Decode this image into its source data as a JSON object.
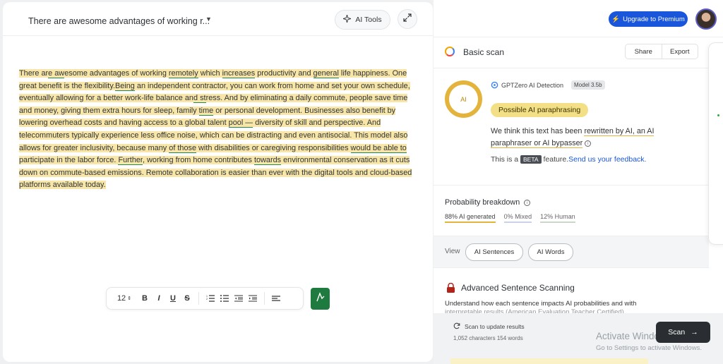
{
  "editor": {
    "doc_title": "There are awesome advantages of working r...",
    "ai_tools_label": "AI Tools",
    "paragraph": [
      {
        "t": "There ar",
        "u": false
      },
      {
        "t": "e aw",
        "u": true
      },
      {
        "t": "esome advantages of working ",
        "u": false
      },
      {
        "t": "remotely",
        "u": true
      },
      {
        "t": " which ",
        "u": false
      },
      {
        "t": "increases",
        "u": true
      },
      {
        "t": "  productivity and ",
        "u": false
      },
      {
        "t": "general",
        "u": true
      },
      {
        "t": " life happiness. ",
        "u": false
      },
      {
        "t": "One great benefit is the flexibility.",
        "u": false
      },
      {
        "t": "Being",
        "u": true
      },
      {
        "t": " an independent contractor, you can work from home and set your own schedule, eventually allowing for  a better work-life balance an",
        "u": false
      },
      {
        "t": "d st",
        "u": true
      },
      {
        "t": "ress. And by eliminating a daily commute, people save time and money, giving them extra  hours for sleep, family ",
        "u": false
      },
      {
        "t": "time",
        "u": true
      },
      {
        "t": " or personal development. Businesses also benefit  by lowering overhead costs and having access to a global talent ",
        "u": false
      },
      {
        "t": "pool —",
        "u": true
      },
      {
        "t": " diversity of skill and perspective. And telecommuters typically  experience less office noise, which can be distracting and even antisocial. This model also allows for greater inclusivity, because many ",
        "u": false
      },
      {
        "t": "of those",
        "u": true
      },
      {
        "t": " with disabilities or caregiving responsibilities ",
        "u": false
      },
      {
        "t": "would be able to",
        "u": true
      },
      {
        "t": " participate  in the labor force. ",
        "u": false
      },
      {
        "t": "Further",
        "u": true
      },
      {
        "t": ", working from home contributes ",
        "u": false
      },
      {
        "t": "towards",
        "u": true
      },
      {
        "t": "  environmental conservation as it cuts down on commute-based emissions. Remote collaboration is easier than ever with the digital tools and cloud-based platforms available  today.",
        "u": false
      }
    ],
    "toolbar": {
      "font_size": "12",
      "bold": "B",
      "italic": "I",
      "underline": "U",
      "strike": "S"
    }
  },
  "panel": {
    "upgrade_label": "Upgrade to Premium",
    "title": "Basic scan",
    "share": "Share",
    "export": "Export",
    "ring_label": "AI",
    "detector": "GPTZero AI Detection",
    "model": "Model 3.5b",
    "verdict": "Possible AI paraphrasing",
    "explain_pre": "We think this text has been ",
    "explain_hl": "rewritten by AI, an AI paraphraser or AI bypasser",
    "beta_pre": "This is a ",
    "beta": "BETA",
    "beta_post": " feature.",
    "feedback": "Send us your feedback.",
    "prob_title": "Probability breakdown",
    "prob_ai": "88% AI generated",
    "prob_mixed": "0% Mixed",
    "prob_human": "12% Human",
    "view": "View",
    "ai_sentences": "AI Sentences",
    "ai_words": "AI Words",
    "adv_title": "Advanced Sentence Scanning",
    "adv_desc": "Understand how each sentence impacts AI probabilities and with",
    "adv_desc2": "interpretable results (American Evaluation Teacher Certified)",
    "scan_note": "Scan to update results",
    "scan_count": "1,052 characters 154 words",
    "activate": "Activate Windows",
    "activate_sub": "Go to Settings to activate Windows.",
    "scan": "Scan"
  },
  "colors": {
    "highlight": "#f8e6a8",
    "underline": "#1f8a4a",
    "accent": "#1a56db",
    "ring": "#e4b33b",
    "verdict_bg": "#f3df86"
  }
}
